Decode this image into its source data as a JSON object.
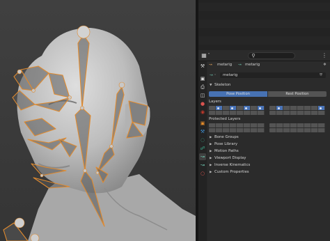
{
  "properties": {
    "header": {
      "object_name": "metarig",
      "data_name": "metarig",
      "search_placeholder": ""
    },
    "datablock_field": "metarig",
    "sections": {
      "skeleton": "Skeleton",
      "pose_position": "Pose Position",
      "rest_position": "Rest Position",
      "layers": "Layers",
      "protected_layers": "Protected Layers",
      "collapsed": [
        "Bone Groups",
        "Pose Library",
        "Motion Paths",
        "Viewport Display",
        "Inverse Kinematics",
        "Custom Properties"
      ]
    },
    "layers_on": [
      [
        1,
        3,
        5,
        7
      ],
      [
        1,
        7
      ]
    ]
  },
  "colors": {
    "accent": "#4772b3",
    "rig": "#e08a2e",
    "viewport": "#3b3b3b"
  }
}
